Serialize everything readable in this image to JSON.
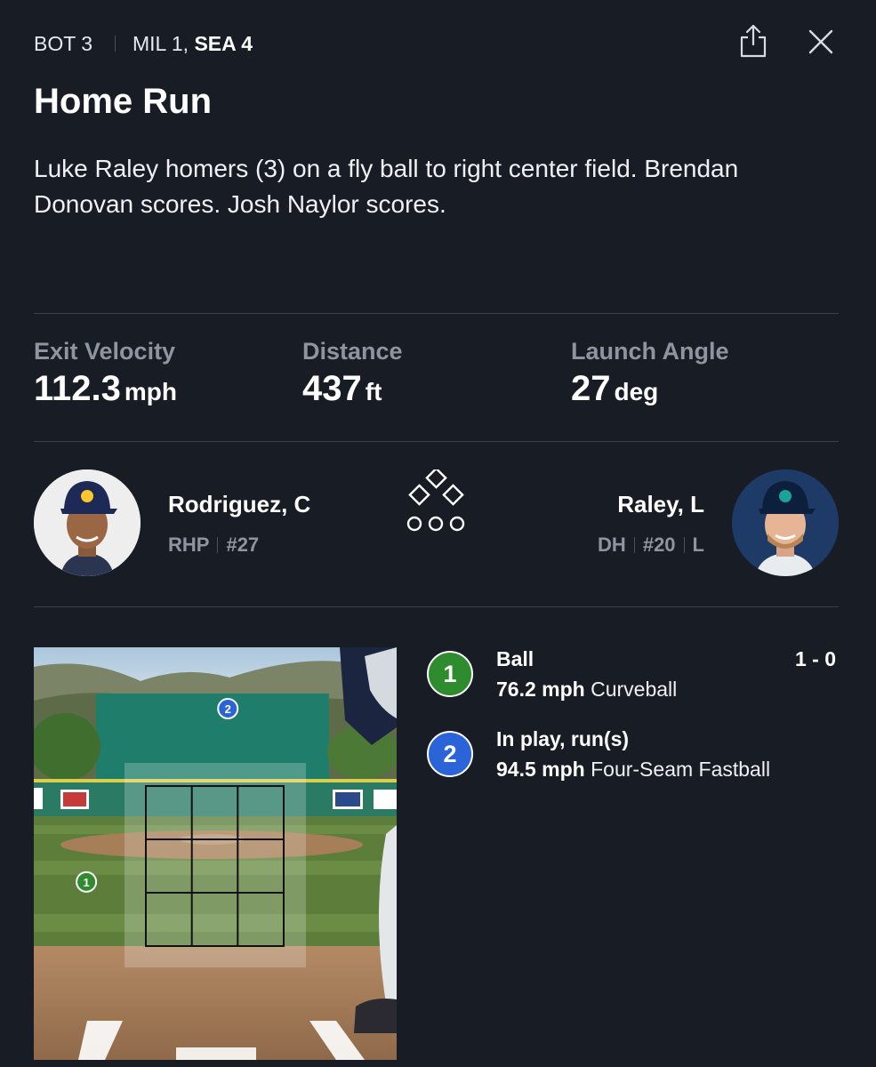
{
  "header": {
    "inning": "BOT 3",
    "away_score": "MIL 1,",
    "home_score": "SEA 4",
    "share_icon": "share-icon",
    "close_icon": "close-icon"
  },
  "play": {
    "title": "Home Run",
    "description": "Luke Raley homers (3) on a fly ball to right center field. Brendan Donovan scores. Josh Naylor scores."
  },
  "stats": [
    {
      "label": "Exit Velocity",
      "value": "112.3",
      "unit": "mph"
    },
    {
      "label": "Distance",
      "value": "437",
      "unit": "ft"
    },
    {
      "label": "Launch Angle",
      "value": "27",
      "unit": "deg"
    }
  ],
  "pitcher": {
    "name": "Rodriguez, C",
    "position": "RHP",
    "number": "#27"
  },
  "batter": {
    "name": "Raley, L",
    "position": "DH",
    "number": "#20",
    "bats": "L"
  },
  "bases_icon": "bases-and-outs-icon",
  "pitches": [
    {
      "number": "1",
      "result": "Ball",
      "count": "1 - 0",
      "speed": "76.2 mph",
      "type": "Curveball",
      "color": "#2e8b2e",
      "zone_x": 0.14,
      "zone_y": 0.56
    },
    {
      "number": "2",
      "result": "In play, run(s)",
      "count": "",
      "speed": "94.5 mph",
      "type": "Four-Seam Fastball",
      "color": "#2b63d8",
      "zone_x": 0.53,
      "zone_y": 0.14
    }
  ],
  "colors": {
    "background": "#181c25",
    "divider": "#3a3f4a",
    "muted_text": "#8f95a0",
    "ball_green": "#2e8b2e",
    "in_play_blue": "#2b63d8"
  }
}
